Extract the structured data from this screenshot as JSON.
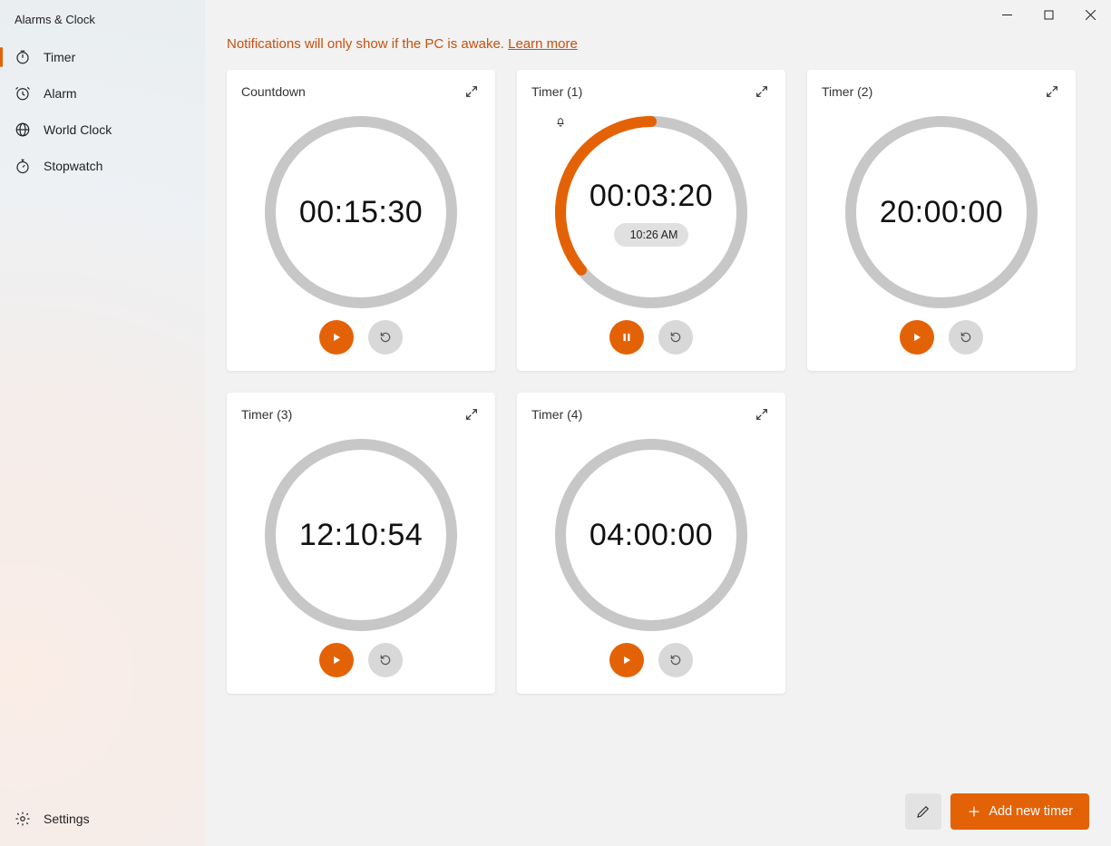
{
  "app_title": "Alarms & Clock",
  "sidebar": {
    "items": [
      {
        "label": "Timer",
        "selected": true
      },
      {
        "label": "Alarm",
        "selected": false
      },
      {
        "label": "World Clock",
        "selected": false
      },
      {
        "label": "Stopwatch",
        "selected": false
      }
    ],
    "settings_label": "Settings"
  },
  "notification": {
    "text": "Notifications will only show if the PC is awake. ",
    "link_label": "Learn more"
  },
  "timers": [
    {
      "name": "Countdown",
      "time": "00:15:30",
      "progress": 0,
      "running": false,
      "end_time": null
    },
    {
      "name": "Timer (1)",
      "time": "00:03:20",
      "progress": 0.36,
      "running": true,
      "end_time": "10:26 AM"
    },
    {
      "name": "Timer (2)",
      "time": "20:00:00",
      "progress": 0,
      "running": false,
      "end_time": null
    },
    {
      "name": "Timer (3)",
      "time": "12:10:54",
      "progress": 0,
      "running": false,
      "end_time": null
    },
    {
      "name": "Timer (4)",
      "time": "04:00:00",
      "progress": 0,
      "running": false,
      "end_time": null
    }
  ],
  "toolbar": {
    "add_label": "Add new timer"
  },
  "colors": {
    "accent": "#e46206"
  }
}
